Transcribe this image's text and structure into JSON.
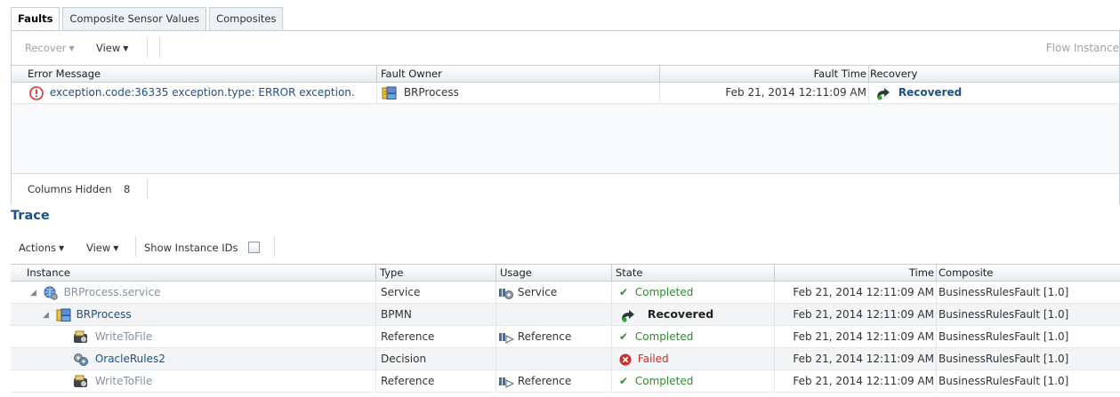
{
  "tabs": [
    "Faults",
    "Composite Sensor Values",
    "Composites"
  ],
  "faults": {
    "toolbar": {
      "recover": "Recover",
      "view": "View",
      "flow_instance": "Flow Instance"
    },
    "columns": {
      "error_message": "Error Message",
      "fault_owner": "Fault Owner",
      "fault_time": "Fault Time",
      "recovery": "Recovery"
    },
    "row": {
      "error_message": "exception.code:36335 exception.type: ERROR exception.",
      "fault_owner": "BRProcess",
      "fault_time": "Feb 21, 2014 12:11:09 AM",
      "recovery": "Recovered"
    },
    "footer": {
      "columns_hidden_label": "Columns Hidden",
      "columns_hidden_count": "8"
    }
  },
  "trace": {
    "title": "Trace",
    "toolbar": {
      "actions": "Actions",
      "view": "View",
      "show_instance_ids": "Show Instance IDs"
    },
    "columns": {
      "instance": "Instance",
      "type": "Type",
      "usage": "Usage",
      "state": "State",
      "time": "Time",
      "composite": "Composite"
    },
    "rows": [
      {
        "instance": "BRProcess.service",
        "type": "Service",
        "usage": "Service",
        "state": "Completed",
        "time": "Feb 21, 2014 12:11:09 AM",
        "composite": "BusinessRulesFault [1.0]"
      },
      {
        "instance": "BRProcess",
        "type": "BPMN",
        "usage": "",
        "state": "Recovered",
        "time": "Feb 21, 2014 12:11:09 AM",
        "composite": "BusinessRulesFault [1.0]"
      },
      {
        "instance": "WriteToFile",
        "type": "Reference",
        "usage": "Reference",
        "state": "Completed",
        "time": "Feb 21, 2014 12:11:09 AM",
        "composite": "BusinessRulesFault [1.0]"
      },
      {
        "instance": "OracleRules2",
        "type": "Decision",
        "usage": "",
        "state": "Failed",
        "time": "Feb 21, 2014 12:11:09 AM",
        "composite": "BusinessRulesFault [1.0]"
      },
      {
        "instance": "WriteToFile",
        "type": "Reference",
        "usage": "Reference",
        "state": "Completed",
        "time": "Feb 21, 2014 12:11:09 AM",
        "composite": "BusinessRulesFault [1.0]"
      }
    ]
  },
  "icons": {
    "error": "error-circle-icon",
    "process": "bpmn-process-icon",
    "recovered": "recovered-arrow-icon",
    "service": "service-globe-icon",
    "reference": "reference-icon",
    "adapter": "file-adapter-icon",
    "rules": "business-rules-icon",
    "check": "check-icon",
    "failed": "failed-x-icon"
  },
  "colors": {
    "link": "#1d4f8b",
    "completed": "#2e8b2e",
    "failed": "#d02a2a",
    "error": "#d9302f"
  }
}
